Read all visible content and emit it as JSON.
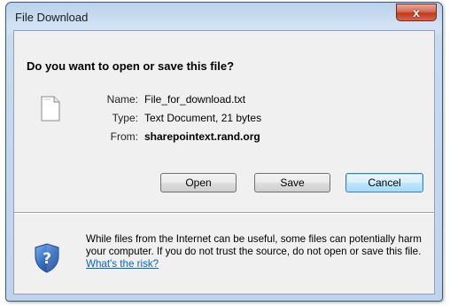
{
  "dialog": {
    "title": "File Download",
    "close_label": "x",
    "question": "Do you want to open or save this file?",
    "file": {
      "icon": "text-file-icon",
      "name_label": "Name:",
      "name_value": "File_for_download.txt",
      "type_label": "Type:",
      "type_value": "Text Document, 21 bytes",
      "from_label": "From:",
      "from_value": "sharepointext.rand.org"
    },
    "buttons": {
      "open": "Open",
      "save": "Save",
      "cancel": "Cancel"
    },
    "warning": {
      "icon": "security-shield-question-icon",
      "text": "While files from the Internet can be useful, some files can potentially harm your computer. If you do not trust the source, do not open or save this file.",
      "link": "What's the risk?"
    }
  },
  "colors": {
    "title_bar": "#c8dbef",
    "close_button": "#c2391c",
    "client_background": "#f0f0f0",
    "link": "#0066cc",
    "default_button_border": "#3c7fb1"
  }
}
